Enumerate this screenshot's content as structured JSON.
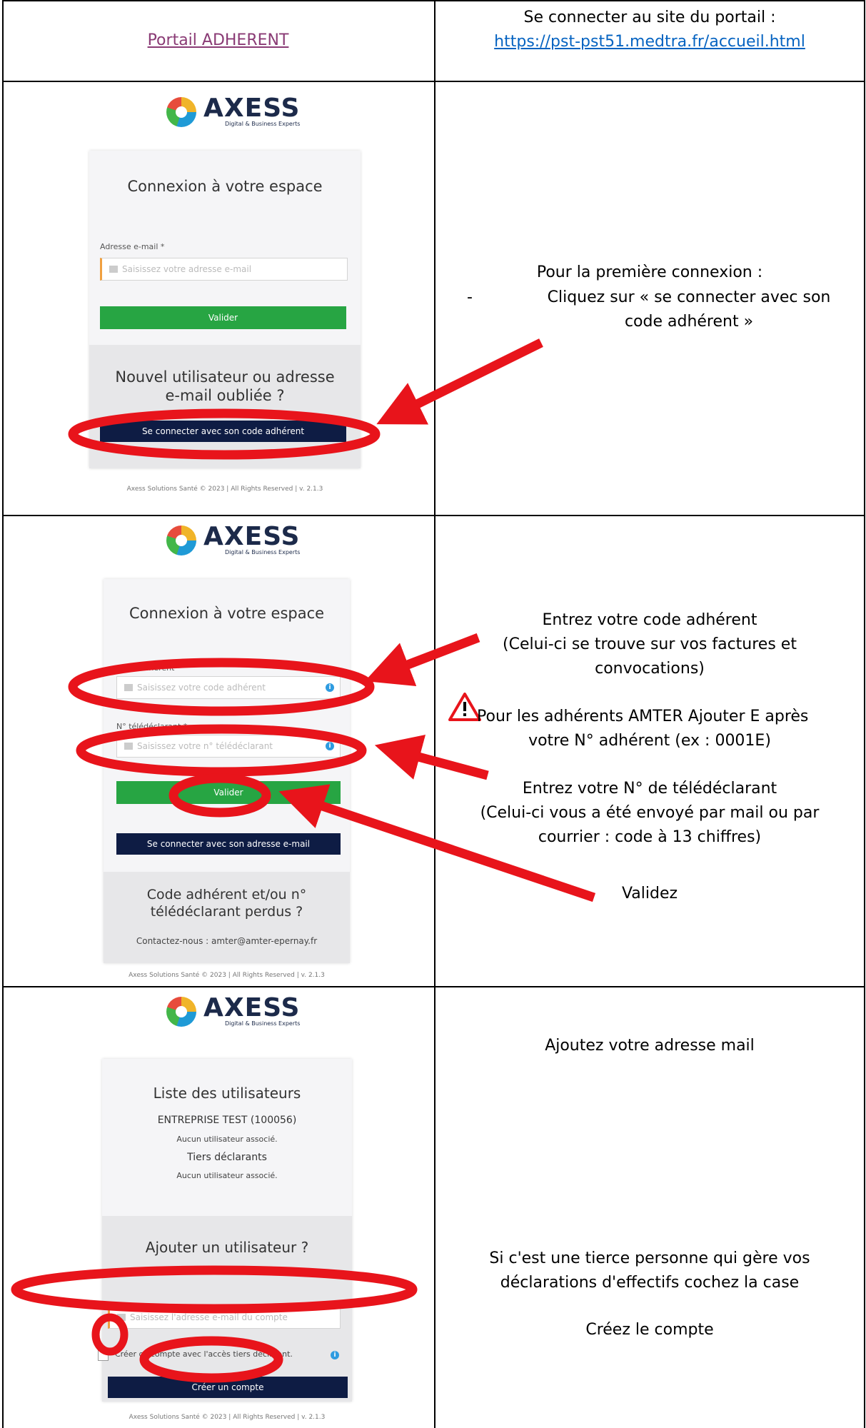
{
  "row1": {
    "left_link": "Portail ADHERENT",
    "right_text": "Se connecter au site du portail :",
    "right_link": "https://pst-pst51.medtra.fr/accueil.html"
  },
  "logo": {
    "name": "AXESS",
    "tagline": "Digital & Business Experts"
  },
  "panel1": {
    "title": "Connexion à votre espace",
    "email_label": "Adresse e-mail *",
    "email_placeholder": "Saisissez votre adresse e-mail",
    "validate": "Valider",
    "new_user": "Nouvel utilisateur ou adresse e-mail oubliée ?",
    "connect_code": "Se connecter avec son code adhérent",
    "footer": "Axess Solutions Santé © 2023 | All Rights Reserved | v. 2.1.3"
  },
  "instructions1": {
    "line1": "Pour la première connexion :",
    "bullet": "-",
    "line2": "Cliquez sur « se connecter avec son",
    "line3": "code adhérent »"
  },
  "panel2": {
    "title": "Connexion à votre espace",
    "code_label": "Code adhérent *",
    "code_placeholder": "Saisissez votre code adhérent",
    "tele_label": "N° télédéclarant *",
    "tele_placeholder": "Saisissez votre n° télédéclarant",
    "validate": "Valider",
    "connect_email": "Se connecter avec son adresse e-mail",
    "lost": "Code adhérent et/ou n° télédéclarant perdus ?",
    "contact": "Contactez-nous : amter@amter-epernay.fr",
    "footer": "Axess Solutions Santé © 2023 | All Rights Reserved | v. 2.1.3"
  },
  "instructions2": {
    "enter_code": "Entrez votre code adhérent",
    "code_hint1": "(Celui-ci se trouve sur vos factures et",
    "code_hint2": "convocations)",
    "amter1": "Pour les adhérents AMTER Ajouter E après",
    "amter2": "votre N° adhérent (ex : 0001E)",
    "enter_tele": "Entrez votre N° de télédéclarant",
    "tele_hint1": "(Celui-ci vous a été envoyé par mail ou par",
    "tele_hint2": "courrier : code à 13 chiffres)",
    "validate": "Validez"
  },
  "panel3": {
    "title": "Liste des utilisateurs",
    "company": "ENTREPRISE TEST (100056)",
    "no_user1": "Aucun utilisateur associé.",
    "tiers": "Tiers déclarants",
    "no_user2": "Aucun utilisateur associé.",
    "add_user": "Ajouter un utilisateur ?",
    "email_placeholder": "Saisissez l'adresse e-mail du compte",
    "checkbox_label": "Créer ce compte avec l'accès tiers déclarant.",
    "create": "Créer un compte",
    "footer": "Axess Solutions Santé © 2023 | All Rights Reserved | v. 2.1.3"
  },
  "instructions3": {
    "add_mail": "Ajoutez votre adresse mail",
    "third1": "Si c'est une tierce personne qui gère vos",
    "third2": "déclarations d'effectifs cochez la case",
    "create": "Créez le compte"
  },
  "colors": {
    "arrow": "#e8141b",
    "navy": "#0e1c44",
    "green": "#27a543",
    "link": "#0563c1"
  }
}
